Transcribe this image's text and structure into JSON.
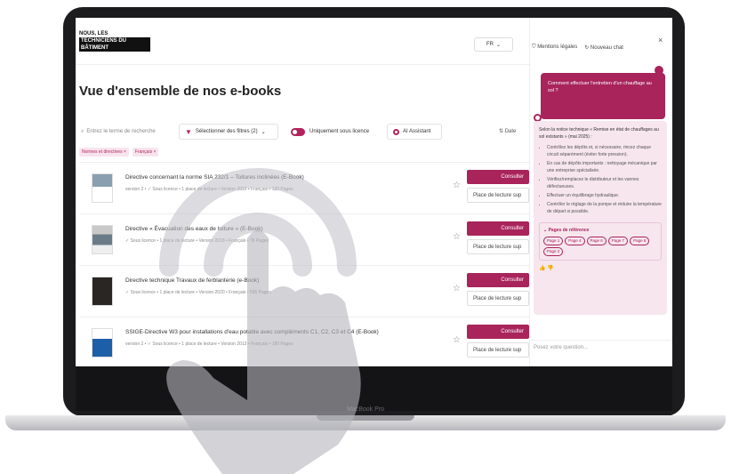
{
  "laptop": {
    "brand_label": "MacBook Pro"
  },
  "header": {
    "logo_line1": "Nous, les",
    "logo_line2": "techniciens du bâtiment",
    "lang_label": "FR"
  },
  "page_title": "Vue d'ensemble de nos e-books",
  "filters": {
    "search_placeholder": "Entrez le terme de recherche",
    "filter_label": "Sélectionner des filtres (2)",
    "toggle_label": "Uniquement sous licence",
    "assistant_label": "AI Assistant",
    "sort_label": "Date",
    "chips": [
      "Normes et directives ×",
      "Français ×"
    ]
  },
  "rows": [
    {
      "title": "Directive concernant la norme SIA 232/1 – Toitures inclinées (E-Book)",
      "meta": "version 2 • ✓ Sous licence • 1 place de lecture • Version 2015 • Français • 120 Pages",
      "consult_label": "Consulter",
      "place_label": "Place de lecture sup"
    },
    {
      "title": "Directive « Évacuation des eaux de toiture » (E-Book)",
      "meta": "✓ Sous licence • 1 place de lecture • Version 2018 • Français • 76 Pages",
      "consult_label": "Consulter",
      "place_label": "Place de lecture sup"
    },
    {
      "title": "Directive technique Travaux de ferblanterie (e-Book)",
      "meta": "✓ Sous licence • 1 place de lecture • Version 2020 • Français • 536 Pages",
      "consult_label": "Consulter",
      "place_label": "Place de lecture sup"
    },
    {
      "title": "SSIGE-Directive W3 pour installations d'eau potable avec compléments C1, C2, C3 et C4 (E-Book)",
      "meta": "version 2 • ✓ Sous licence • 1 place de lecture • Version 2013 • Français • 190 Pages",
      "consult_label": "Consulter",
      "place_label": "Place de lecture sup"
    }
  ],
  "chat": {
    "legal_label": "Mentions légales",
    "new_chat_label": "Nouveau chat",
    "user_message": "Comment effectuer l'entretien d'un chauffage au sol ?",
    "bot_intro": "Selon la notice technique « Remise en état de chauffages au sol existants » (mai 2025) :",
    "bot_points": [
      "Contrôlez les dépôts et, si nécessaire, rincez chaque circuit séparément (éviter forte pression).",
      "En cas de dépôts importants : nettoyage mécanique par une entreprise spécialisée.",
      "Vérifiez/remplacez le distributeur et les vannes défectueuses.",
      "Effectuer un équilibrage hydraulique.",
      "Contrôler le réglage de la pompe et réduire la température de départ si possible."
    ],
    "refs_title": "Pages de référence",
    "ref_pages": [
      "Page 1",
      "Page 4",
      "Page 6",
      "Page 7",
      "Page 8",
      "Page 2"
    ],
    "input_placeholder": "Posez votre question..."
  },
  "colors": {
    "accent": "#a8245b",
    "laptop_body": "#1c1c1e"
  },
  "icons": [
    "search-icon",
    "funnel-icon",
    "star-icon",
    "close-icon",
    "shield-icon",
    "refresh-icon",
    "tap-hand-icon"
  ]
}
